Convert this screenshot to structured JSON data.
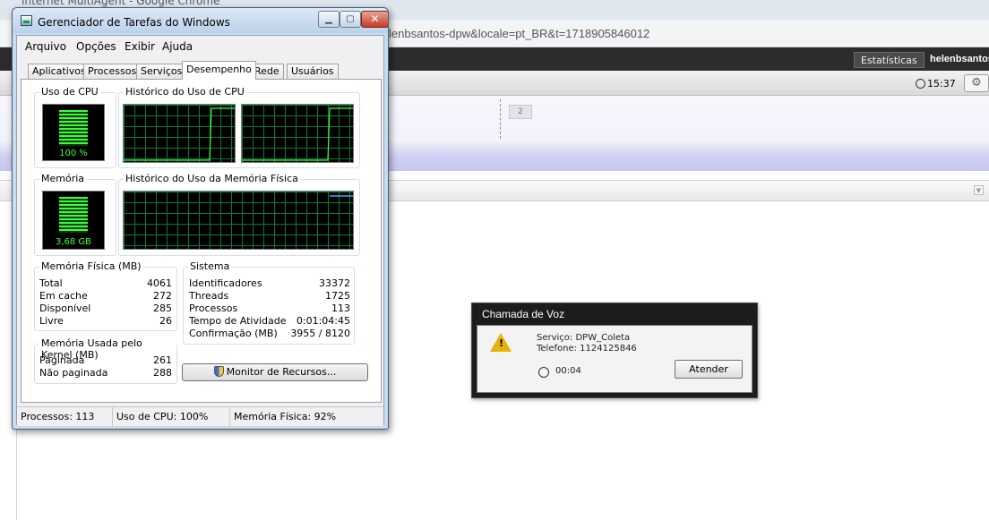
{
  "browser": {
    "title": "Internet MultiAgent - Google Chrome",
    "url_fragment": "lenbsantos-dpw&locale=pt_BR&t=1718905846012",
    "stats_button": "Estatísticas",
    "username": "helenbsantos",
    "clock": "15:37",
    "page_number": "2"
  },
  "task_manager": {
    "title": "Gerenciador de Tarefas do Windows",
    "menu": [
      "Arquivo",
      "Opções",
      "Exibir",
      "Ajuda"
    ],
    "tabs": [
      "Aplicativos",
      "Processos",
      "Serviços",
      "Desempenho",
      "Rede",
      "Usuários"
    ],
    "active_tab": "Desempenho",
    "cpu_usage_label": "Uso de CPU",
    "cpu_usage_value": "100 %",
    "cpu_history_label": "Histórico do Uso de CPU",
    "memory_label": "Memória",
    "memory_value": "3,68 GB",
    "memory_history_label": "Histórico do Uso da Memória Física",
    "physical_memory": {
      "label": "Memória Física (MB)",
      "rows": [
        {
          "k": "Total",
          "v": "4061"
        },
        {
          "k": "Em cache",
          "v": "272"
        },
        {
          "k": "Disponível",
          "v": "285"
        },
        {
          "k": "Livre",
          "v": "26"
        }
      ]
    },
    "kernel_memory": {
      "label": "Memória Usada pelo Kernel (MB)",
      "rows": [
        {
          "k": "Paginada",
          "v": "261"
        },
        {
          "k": "Não paginada",
          "v": "288"
        }
      ]
    },
    "system": {
      "label": "Sistema",
      "rows": [
        {
          "k": "Identificadores",
          "v": "33372"
        },
        {
          "k": "Threads",
          "v": "1725"
        },
        {
          "k": "Processos",
          "v": "113"
        },
        {
          "k": "Tempo de Atividade",
          "v": "0:01:04:45"
        },
        {
          "k": "Confirmação (MB)",
          "v": "3955 / 8120"
        }
      ]
    },
    "resource_monitor_button": "Monitor de Recursos...",
    "status": {
      "processes": "Processos: 113",
      "cpu": "Uso de CPU: 100%",
      "memory": "Memória Física: 92%"
    }
  },
  "call_dialog": {
    "title": "Chamada de Voz",
    "service": "Serviço: DPW_Coleta",
    "phone": "Telefone: 1124125846",
    "timer": "00:04",
    "answer_button": "Atender"
  },
  "colors": {
    "graph_green": "#39ff39",
    "memory_line": "#4aa0ff",
    "call_title_bg": "#1c1c1c"
  }
}
